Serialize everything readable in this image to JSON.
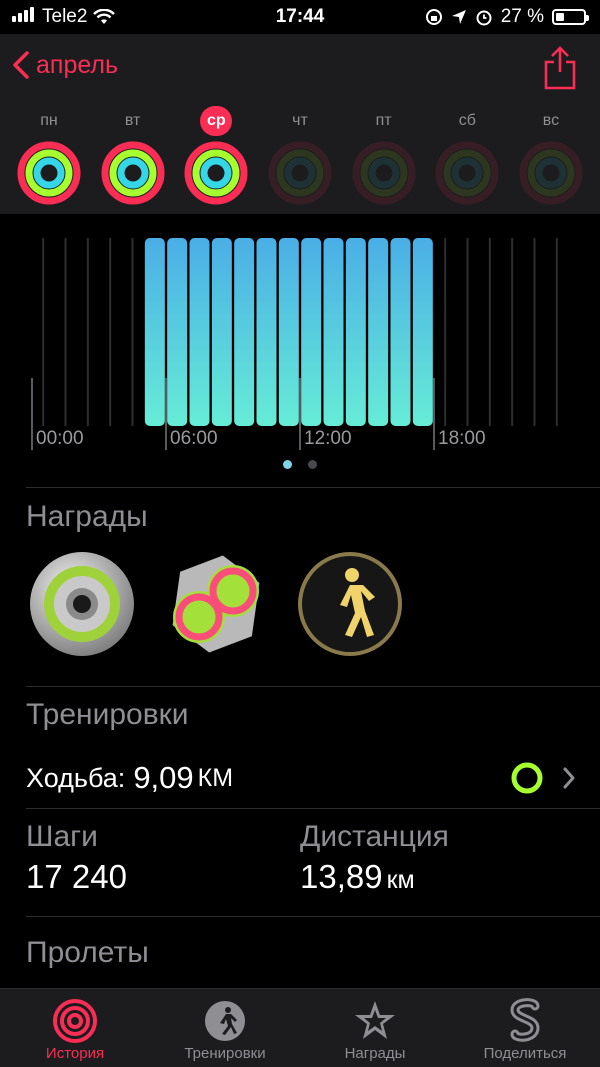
{
  "status_bar": {
    "carrier": "Tele2",
    "time": "17:44",
    "battery": "27 %"
  },
  "header": {
    "back_label": "апрель"
  },
  "week": [
    {
      "label": "пн",
      "state": "past"
    },
    {
      "label": "вт",
      "state": "past"
    },
    {
      "label": "ср",
      "state": "selected"
    },
    {
      "label": "чт",
      "state": "future"
    },
    {
      "label": "пт",
      "state": "future"
    },
    {
      "label": "сб",
      "state": "future"
    },
    {
      "label": "вс",
      "state": "future"
    }
  ],
  "colors": {
    "move": "#fa2d55",
    "exercise": "#a6ff2f",
    "stand": "#35d6e8",
    "accent": "#fa2d55"
  },
  "chart_data": {
    "type": "bar",
    "x_ticks": [
      "00:00",
      "06:00",
      "12:00",
      "18:00"
    ],
    "stand_hours": [
      0,
      0,
      0,
      0,
      0,
      1,
      1,
      1,
      1,
      1,
      1,
      1,
      1,
      1,
      1,
      1,
      1,
      1,
      0,
      0,
      0,
      0,
      0,
      0
    ],
    "pages": 2,
    "current_page": 0
  },
  "awards": {
    "title": "Награды",
    "items": [
      {
        "icon": "ring-award-icon"
      },
      {
        "icon": "infinity-award-icon"
      },
      {
        "icon": "walk-award-icon"
      }
    ]
  },
  "workouts": {
    "title": "Тренировки",
    "item": {
      "name": "Ходьба:",
      "value": "9,09",
      "unit": "КМ"
    }
  },
  "stats": {
    "steps_label": "Шаги",
    "steps_value": "17 240",
    "distance_label": "Дистанция",
    "distance_value": "13,89",
    "distance_unit": "км",
    "flights_label": "Пролеты"
  },
  "tabs": [
    {
      "label": "История",
      "icon": "history-rings-icon",
      "active": true
    },
    {
      "label": "Тренировки",
      "icon": "workouts-runner-icon",
      "active": false
    },
    {
      "label": "Награды",
      "icon": "awards-star-icon",
      "active": false
    },
    {
      "label": "Поделиться",
      "icon": "share-s-icon",
      "active": false
    }
  ]
}
